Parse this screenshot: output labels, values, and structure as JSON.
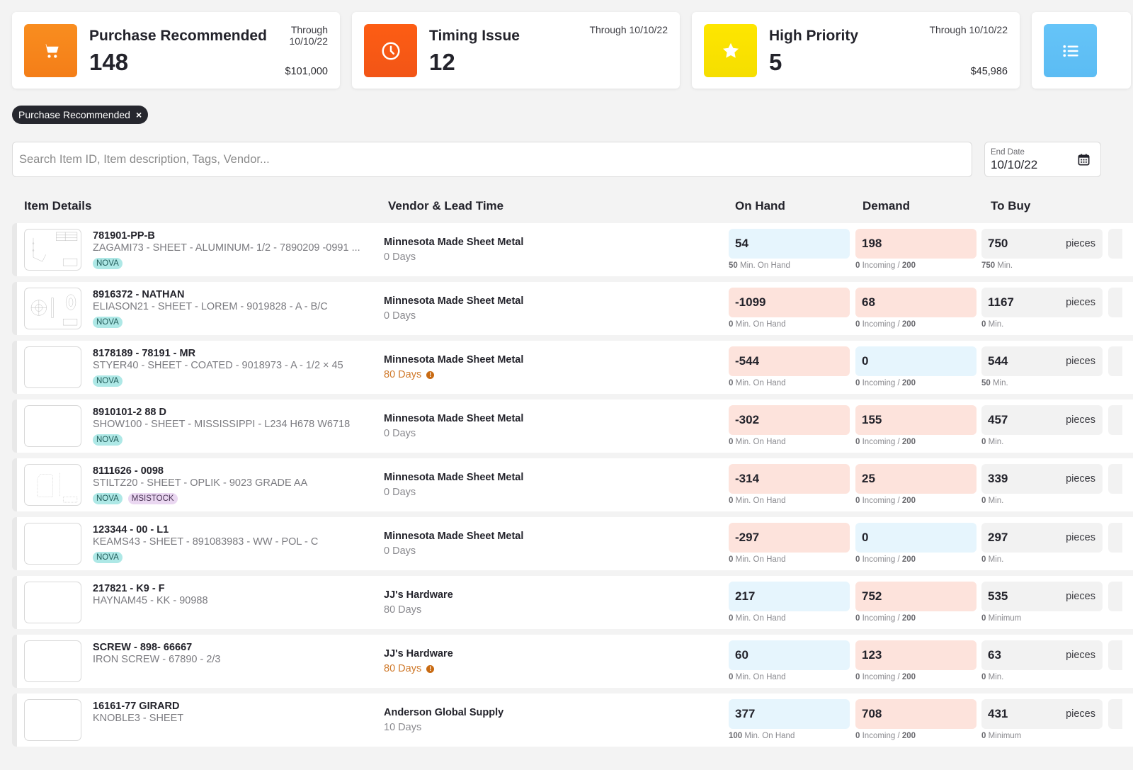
{
  "cards": [
    {
      "title": "Purchase Recommended",
      "count": "148",
      "through": "Through 10/10/22",
      "amount": "$101,000",
      "icon": "shopping-cart-icon",
      "color": "#f7861d"
    },
    {
      "title": "Timing Issue",
      "count": "12",
      "through": "Through 10/10/22",
      "amount": "",
      "icon": "clock-icon",
      "color": "#fb5b16"
    },
    {
      "title": "High Priority",
      "count": "5",
      "through": "Through 10/10/22",
      "amount": "$45,986",
      "icon": "star-icon",
      "color": "#fde400"
    },
    {
      "title": "",
      "count": "",
      "through": "",
      "amount": "",
      "icon": "list-icon",
      "color": "#62c2f7"
    }
  ],
  "filter_chip": {
    "label": "Purchase Recommended",
    "close": "×"
  },
  "search": {
    "placeholder": "Search Item ID, Item description, Tags, Vendor...",
    "value": ""
  },
  "end_date": {
    "label": "End Date",
    "value": "10/10/22"
  },
  "columns": {
    "item": "Item Details",
    "vendor": "Vendor & Lead Time",
    "on_hand": "On Hand",
    "demand": "Demand",
    "to_buy": "To Buy"
  },
  "rows": [
    {
      "id": "781901-PP-B",
      "desc": "ZAGAMI73 - SHEET - ALUMINUM- 1/2 - 7890209 -0991 ...",
      "tags": [
        "NOVA"
      ],
      "thumb": "drawing-a",
      "vendor": "Minnesota Made Sheet Metal",
      "lead": "0 Days",
      "lead_warn": false,
      "on_hand": "54",
      "on_hand_state": "blue",
      "min_on_hand": "50",
      "min_on_hand_label": "Min. On Hand",
      "demand": "198",
      "demand_state": "red",
      "incoming": "0",
      "incoming_label": "Incoming",
      "incoming_total": "200",
      "to_buy": "750",
      "unit": "pieces",
      "min": "750",
      "min_label": "Min."
    },
    {
      "id": "8916372 - NATHAN",
      "desc": "ELIASON21 - SHEET - LOREM - 9019828 - A - B/C",
      "tags": [
        "NOVA"
      ],
      "thumb": "drawing-b",
      "vendor": "Minnesota Made Sheet Metal",
      "lead": "0 Days",
      "lead_warn": false,
      "on_hand": "-1099",
      "on_hand_state": "red",
      "min_on_hand": "0",
      "min_on_hand_label": "Min. On Hand",
      "demand": "68",
      "demand_state": "red",
      "incoming": "0",
      "incoming_label": "Incoming",
      "incoming_total": "200",
      "to_buy": "1167",
      "unit": "pieces",
      "min": "0",
      "min_label": "Min."
    },
    {
      "id": "8178189 - 78191 - MR",
      "desc": "STYER40 - SHEET - COATED - 9018973 - A - 1/2 × 45",
      "tags": [
        "NOVA"
      ],
      "thumb": "",
      "vendor": "Minnesota Made Sheet Metal",
      "lead": "80 Days",
      "lead_warn": true,
      "on_hand": "-544",
      "on_hand_state": "red",
      "min_on_hand": "0",
      "min_on_hand_label": "Min. On Hand",
      "demand": "0",
      "demand_state": "blue",
      "incoming": "0",
      "incoming_label": "Incoming",
      "incoming_total": "200",
      "to_buy": "544",
      "unit": "pieces",
      "min": "50",
      "min_label": "Min."
    },
    {
      "id": "8910101-2 88 D",
      "desc": "SHOW100 - SHEET - MISSISSIPPI - L234 H678 W6718",
      "tags": [
        "NOVA"
      ],
      "thumb": "",
      "vendor": "Minnesota Made Sheet Metal",
      "lead": "0 Days",
      "lead_warn": false,
      "on_hand": "-302",
      "on_hand_state": "red",
      "min_on_hand": "0",
      "min_on_hand_label": "Min. On Hand",
      "demand": "155",
      "demand_state": "red",
      "incoming": "0",
      "incoming_label": "Incoming",
      "incoming_total": "200",
      "to_buy": "457",
      "unit": "pieces",
      "min": "0",
      "min_label": "Min."
    },
    {
      "id": "8111626 - 0098",
      "desc": "STILTZ20 - SHEET - OPLIK - 9023 GRADE AA",
      "tags": [
        "NOVA",
        "MSISTOCK"
      ],
      "thumb": "drawing-c",
      "vendor": "Minnesota Made Sheet Metal",
      "lead": "0 Days",
      "lead_warn": false,
      "on_hand": "-314",
      "on_hand_state": "red",
      "min_on_hand": "0",
      "min_on_hand_label": "Min. On Hand",
      "demand": "25",
      "demand_state": "red",
      "incoming": "0",
      "incoming_label": "Incoming",
      "incoming_total": "200",
      "to_buy": "339",
      "unit": "pieces",
      "min": "0",
      "min_label": "Min."
    },
    {
      "id": "123344 - 00 - L1",
      "desc": "KEAMS43 - SHEET - 891083983 - WW - POL - C",
      "tags": [
        "NOVA"
      ],
      "thumb": "",
      "vendor": "Minnesota Made Sheet Metal",
      "lead": "0 Days",
      "lead_warn": false,
      "on_hand": "-297",
      "on_hand_state": "red",
      "min_on_hand": "0",
      "min_on_hand_label": "Min. On Hand",
      "demand": "0",
      "demand_state": "blue",
      "incoming": "0",
      "incoming_label": "Incoming",
      "incoming_total": "200",
      "to_buy": "297",
      "unit": "pieces",
      "min": "0",
      "min_label": "Min."
    },
    {
      "id": "217821 - K9 - F",
      "desc": "HAYNAM45 - KK - 90988",
      "tags": [],
      "thumb": "",
      "vendor": "JJ's Hardware",
      "lead": "80 Days",
      "lead_warn": false,
      "on_hand": "217",
      "on_hand_state": "blue",
      "min_on_hand": "0",
      "min_on_hand_label": "Min. On Hand",
      "demand": "752",
      "demand_state": "red",
      "incoming": "0",
      "incoming_label": "Incoming",
      "incoming_total": "200",
      "to_buy": "535",
      "unit": "pieces",
      "min": "0",
      "min_label": "Minimum"
    },
    {
      "id": "SCREW - 898- 66667",
      "desc": "IRON SCREW - 67890 - 2/3",
      "tags": [],
      "thumb": "",
      "vendor": "JJ's Hardware",
      "lead": "80 Days",
      "lead_warn": true,
      "on_hand": "60",
      "on_hand_state": "blue",
      "min_on_hand": "0",
      "min_on_hand_label": "Min. On Hand",
      "demand": "123",
      "demand_state": "red",
      "incoming": "0",
      "incoming_label": "Incoming",
      "incoming_total": "200",
      "to_buy": "63",
      "unit": "pieces",
      "min": "0",
      "min_label": "Min."
    },
    {
      "id": "16161-77 GIRARD",
      "desc": "KNOBLE3 - SHEET",
      "tags": [],
      "thumb": "",
      "vendor": "Anderson Global Supply",
      "lead": "10 Days",
      "lead_warn": false,
      "on_hand": "377",
      "on_hand_state": "blue",
      "min_on_hand": "100",
      "min_on_hand_label": "Min. On Hand",
      "demand": "708",
      "demand_state": "red",
      "incoming": "0",
      "incoming_label": "Incoming",
      "incoming_total": "200",
      "to_buy": "431",
      "unit": "pieces",
      "min": "0",
      "min_label": "Minimum"
    }
  ]
}
